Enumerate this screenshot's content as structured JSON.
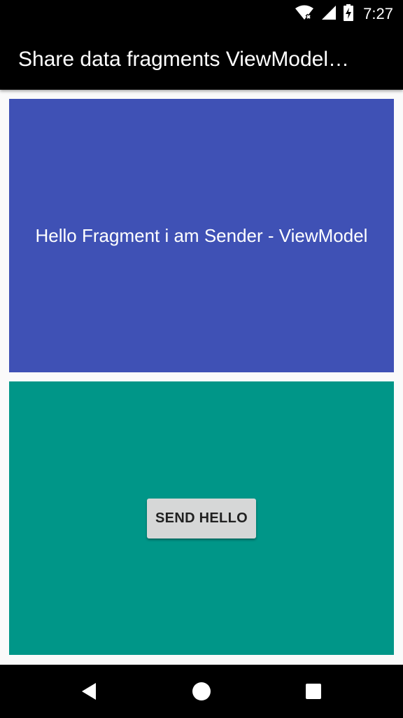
{
  "status_bar": {
    "time": "7:27",
    "icons": [
      "wifi-icon",
      "cell-signal-icon",
      "battery-charging-icon"
    ]
  },
  "app_bar": {
    "title": "Share data fragments ViewModel…"
  },
  "sender_fragment": {
    "message": "Hello Fragment i am Sender - ViewModel",
    "background_color": "#3f51b5"
  },
  "receiver_fragment": {
    "button_label": "SEND HELLO",
    "background_color": "#009688"
  },
  "nav_bar": {
    "buttons": [
      "back-icon",
      "home-icon",
      "recents-icon"
    ]
  }
}
